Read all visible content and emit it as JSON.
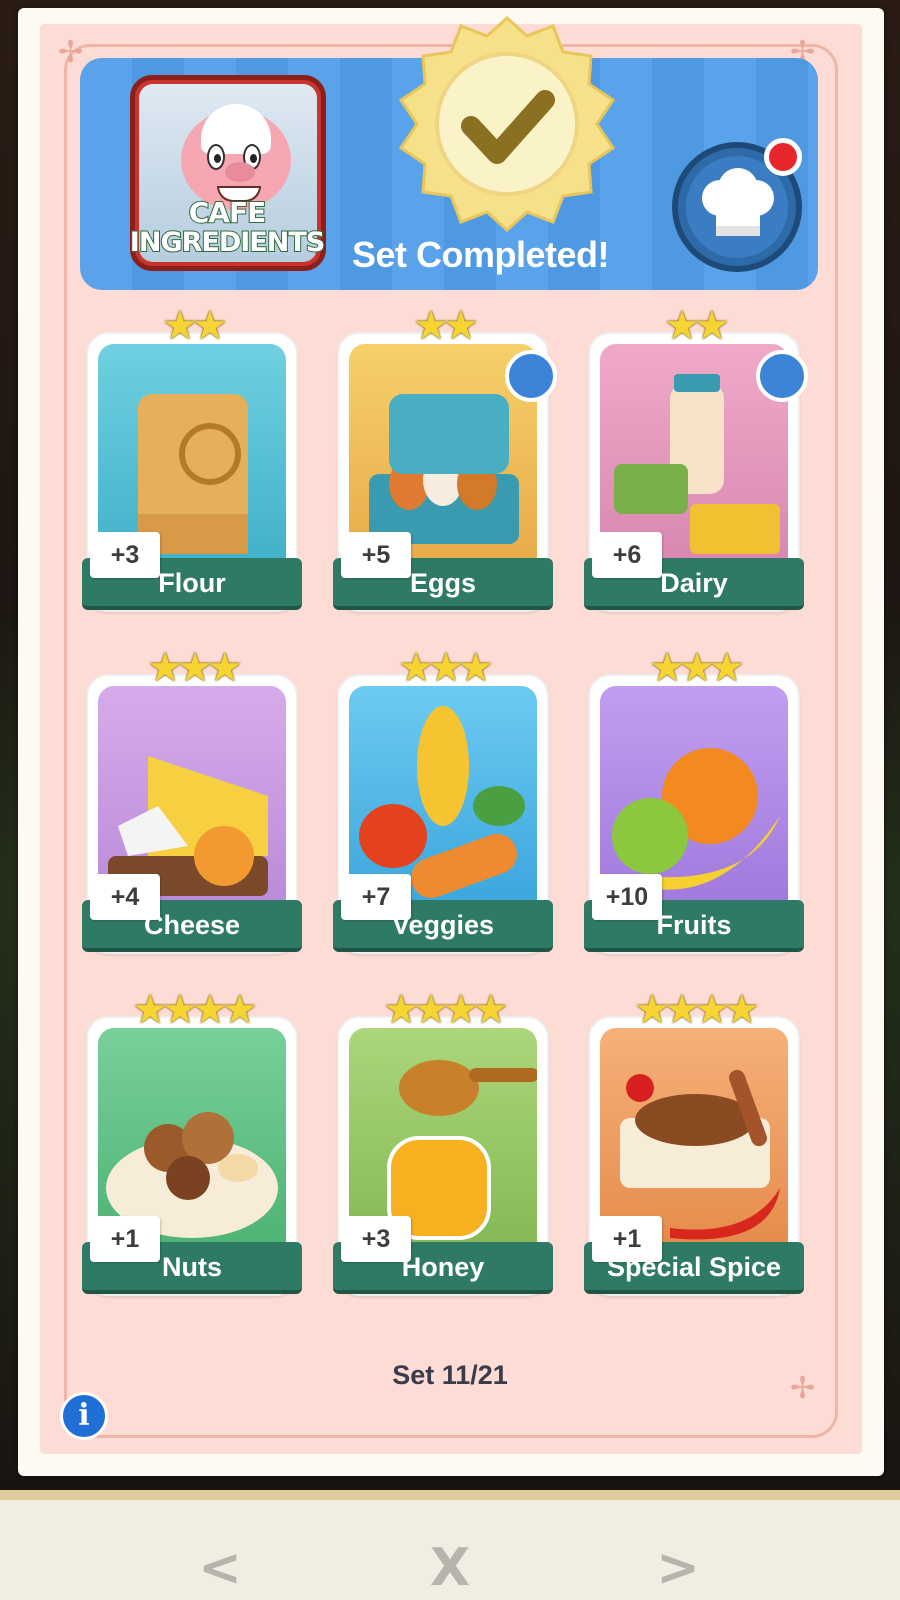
{
  "header": {
    "set_name_line1": "CAFE",
    "set_name_line2": "INGREDIENTS",
    "status": "Set Completed!"
  },
  "cards": [
    {
      "name": "Flour",
      "bonus": "+3",
      "stars": 2,
      "has_chef_badge": false,
      "art_color": "#5fc6d8"
    },
    {
      "name": "Eggs",
      "bonus": "+5",
      "stars": 2,
      "has_chef_badge": true,
      "art_color": "#f0c45a"
    },
    {
      "name": "Dairy",
      "bonus": "+6",
      "stars": 2,
      "has_chef_badge": true,
      "art_color": "#e79fbf"
    },
    {
      "name": "Cheese",
      "bonus": "+4",
      "stars": 3,
      "has_chef_badge": false,
      "art_color": "#c79be3"
    },
    {
      "name": "Veggies",
      "bonus": "+7",
      "stars": 3,
      "has_chef_badge": false,
      "art_color": "#5ebfe6"
    },
    {
      "name": "Fruits",
      "bonus": "+10",
      "stars": 3,
      "has_chef_badge": false,
      "art_color": "#b58fe4"
    },
    {
      "name": "Nuts",
      "bonus": "+1",
      "stars": 4,
      "has_chef_badge": false,
      "art_color": "#6cc48b"
    },
    {
      "name": "Honey",
      "bonus": "+3",
      "stars": 4,
      "has_chef_badge": false,
      "art_color": "#9ccc6a"
    },
    {
      "name": "Special Spice",
      "bonus": "+1",
      "stars": 4,
      "has_chef_badge": false,
      "art_color": "#f2a063"
    }
  ],
  "footer": {
    "set_count": "Set 11/21"
  },
  "icons": {
    "info": "i",
    "prev": "<",
    "close": "X",
    "next": ">"
  },
  "colors": {
    "panel": "#fcdcd4",
    "banner": "#5aa3ea",
    "ribbon": "#2f7a64",
    "star": "#f6d432"
  }
}
